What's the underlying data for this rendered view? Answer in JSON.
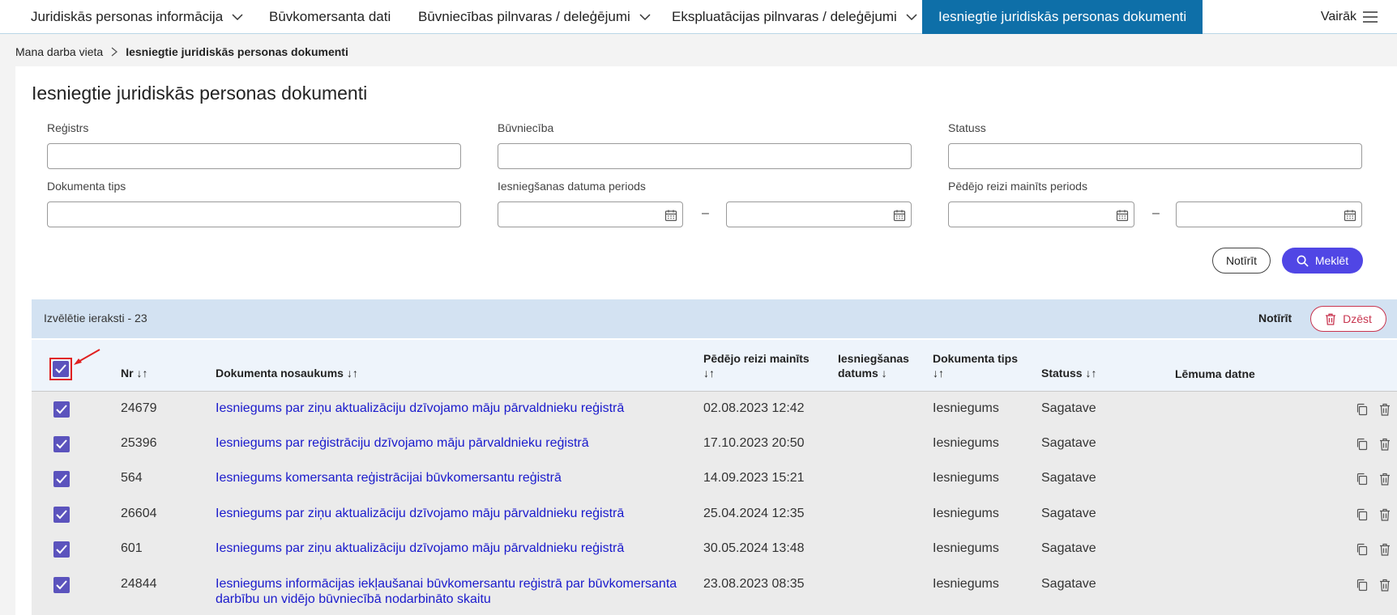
{
  "nav": {
    "items": [
      {
        "label": "Juridiskās personas informācija",
        "has_chevron": true
      },
      {
        "label": "Būvkomersanta dati",
        "has_chevron": false
      },
      {
        "label": "Būvniecības pilnvaras / deleģējumi",
        "has_chevron": true
      },
      {
        "label": "Ekspluatācijas pilnvaras / deleģējumi",
        "has_chevron": true
      },
      {
        "label": "Iesniegtie juridiskās personas dokumenti",
        "has_chevron": false,
        "active": true
      }
    ],
    "more_label": "Vairāk"
  },
  "breadcrumb": {
    "home": "Mana darba vieta",
    "current": "Iesniegtie juridiskās personas dokumenti"
  },
  "page_title": "Iesniegtie juridiskās personas dokumenti",
  "filters": {
    "registrs_label": "Reģistrs",
    "buvnieciba_label": "Būvniecība",
    "statuss_label": "Statuss",
    "doc_tips_label": "Dokumenta tips",
    "iesn_period_label": "Iesniegšanas datuma periods",
    "mainits_period_label": "Pēdējo reizi mainīts periods",
    "dash": "–"
  },
  "buttons": {
    "clear": "Notīrīt",
    "search": "Meklēt"
  },
  "selection": {
    "count_text": "Izvēlētie ieraksti - 23",
    "clear": "Notīrīt",
    "delete": "Dzēst"
  },
  "table": {
    "headers": {
      "nr": "Nr ↓↑",
      "name": "Dokumenta nosaukums ↓↑",
      "modified_line1": "Pēdējo reizi mainīts",
      "modified_line2": "↓↑",
      "submitted_line1": "Iesniegšanas",
      "submitted_line2": "datums ↓",
      "type_line1": "Dokumenta tips",
      "type_line2": "↓↑",
      "status": "Statuss ↓↑",
      "decision": "Lēmuma datne"
    },
    "rows": [
      {
        "nr": "24679",
        "name": "Iesniegums par ziņu aktualizāciju dzīvojamo māju pārvaldnieku reģistrā",
        "name2": "",
        "modified": "02.08.2023 12:42",
        "type": "Iesniegums",
        "status": "Sagatave"
      },
      {
        "nr": "25396",
        "name": "Iesniegums par reģistrāciju dzīvojamo māju pārvaldnieku reģistrā",
        "name2": "",
        "modified": "17.10.2023 20:50",
        "type": "Iesniegums",
        "status": "Sagatave"
      },
      {
        "nr": "564",
        "name": "Iesniegums komersanta reģistrācijai būvkomersantu reģistrā",
        "name2": "",
        "modified": "14.09.2023 15:21",
        "type": "Iesniegums",
        "status": "Sagatave"
      },
      {
        "nr": "26604",
        "name": "Iesniegums par ziņu aktualizāciju dzīvojamo māju pārvaldnieku reģistrā",
        "name2": "",
        "modified": "25.04.2024 12:35",
        "type": "Iesniegums",
        "status": "Sagatave"
      },
      {
        "nr": "601",
        "name": "Iesniegums par ziņu aktualizāciju dzīvojamo māju pārvaldnieku reģistrā",
        "name2": "",
        "modified": "30.05.2024 13:48",
        "type": "Iesniegums",
        "status": "Sagatave"
      },
      {
        "nr": "24844",
        "name": "Iesniegums informācijas iekļaušanai būvkomersantu reģistrā par būvkomersanta",
        "name2": "darbību un vidējo būvniecībā nodarbināto skaitu",
        "modified": "23.08.2023 08:35",
        "type": "Iesniegums",
        "status": "Sagatave"
      }
    ]
  },
  "colors": {
    "accent": "#5046e5",
    "nav_active": "#0e6fa8",
    "danger": "#c8354f",
    "checkbox": "#5b53bd",
    "link": "#1a1acc"
  }
}
